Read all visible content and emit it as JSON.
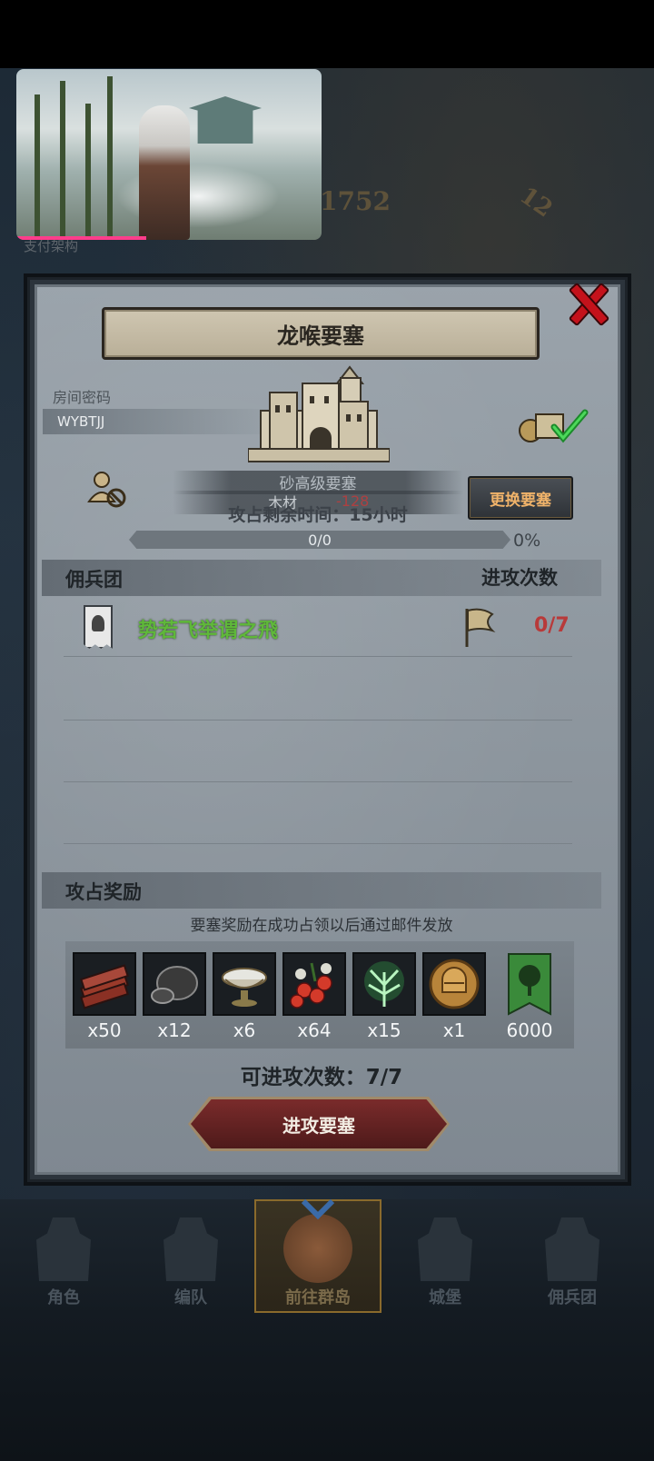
{
  "background": {
    "number_1": "1752",
    "number_2": "12",
    "caption": "支付架构"
  },
  "fortress": {
    "title": "龙喉要塞",
    "room_code_label": "房间密码",
    "room_code": "WYBTJJ",
    "name_overlay": "砂高级要塞",
    "wood_label": "木材",
    "wood_value": "-128",
    "remaining_time": "攻占剩余时间：15小时",
    "change_button": "更换要塞",
    "progress_text": "0/0",
    "progress_percent": "0%",
    "progress_fraction": 0
  },
  "mercenary": {
    "section_title": "佣兵团",
    "attack_count_label": "进攻次数",
    "guilds": [
      {
        "name": "势若飞举谓之飛",
        "count": "0/7"
      }
    ]
  },
  "rewards": {
    "section_title": "攻占奖励",
    "note": "要塞奖励在成功占领以后通过邮件发放",
    "items": [
      {
        "icon": "wood-planks-icon",
        "qty": "x50"
      },
      {
        "icon": "ore-stone-icon",
        "qty": "x12"
      },
      {
        "icon": "silver-bowl-icon",
        "qty": "x6"
      },
      {
        "icon": "berries-icon",
        "qty": "x64"
      },
      {
        "icon": "green-herb-icon",
        "qty": "x15"
      },
      {
        "icon": "knight-helmet-coin-icon",
        "qty": "x1"
      },
      {
        "icon": "tree-banner-icon",
        "qty": "6000"
      }
    ],
    "attempts_text": "可进攻次数：7/7",
    "attack_button": "进攻要塞"
  },
  "nav": {
    "items": [
      {
        "label": "角色"
      },
      {
        "label": "编队"
      },
      {
        "label": "前往群岛"
      },
      {
        "label": "城堡"
      },
      {
        "label": "佣兵团"
      }
    ]
  },
  "colors": {
    "accent_orange": "#f0b36a",
    "guild_green": "#5fb83a",
    "count_red": "#b83a3a",
    "close_red": "#c4121b"
  }
}
